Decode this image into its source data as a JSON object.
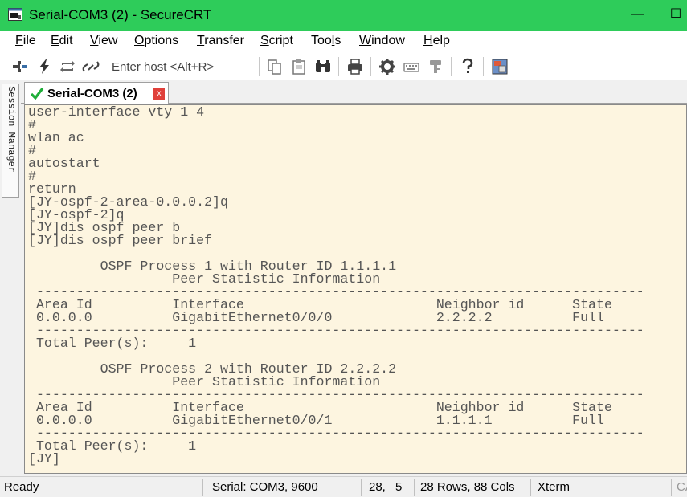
{
  "window": {
    "title": "Serial-COM3 (2) - SecureCRT",
    "minimize_glyph": "—",
    "maximize_glyph": "☐"
  },
  "menu": [
    {
      "label": "File",
      "accel": "F",
      "rest": "ile"
    },
    {
      "label": "Edit",
      "accel": "E",
      "rest": "dit"
    },
    {
      "label": "View",
      "accel": "V",
      "rest": "iew"
    },
    {
      "label": "Options",
      "accel": "O",
      "rest": "ptions"
    },
    {
      "label": "Transfer",
      "accel": "T",
      "rest": "ransfer"
    },
    {
      "label": "Script",
      "accel": "S",
      "rest": "cript"
    },
    {
      "label": "Tools",
      "pre": "Too",
      "accel": "l",
      "rest": "s"
    },
    {
      "label": "Window",
      "accel": "W",
      "rest": "indow"
    },
    {
      "label": "Help",
      "accel": "H",
      "rest": "elp"
    }
  ],
  "toolbar": {
    "host_placeholder": "Enter host <Alt+R>",
    "icons": [
      "connect-bar-icon",
      "quick-connect-icon",
      "reconnect-icon",
      "disconnect-icon",
      "copy-icon",
      "paste-icon",
      "find-icon",
      "print-icon",
      "settings-icon",
      "keymap-icon",
      "key-agent-icon",
      "help-icon",
      "sftp-icon"
    ]
  },
  "side_panel": {
    "label": "Session Manager"
  },
  "session_tab": {
    "label": "Serial-COM3 (2)",
    "close": "x"
  },
  "terminal": {
    "lines": [
      "user-interface vty 1 4",
      "#",
      "wlan ac",
      "#",
      "autostart",
      "#",
      "return",
      "[JY-ospf-2-area-0.0.0.2]q",
      "[JY-ospf-2]q",
      "[JY]dis ospf peer b",
      "[JY]dis ospf peer brief",
      "",
      "         OSPF Process 1 with Router ID 1.1.1.1",
      "                  Peer Statistic Information",
      " ----------------------------------------------------------------------------",
      " Area Id          Interface                        Neighbor id      State",
      " 0.0.0.0          GigabitEthernet0/0/0             2.2.2.2          Full",
      " ----------------------------------------------------------------------------",
      " Total Peer(s):     1",
      "",
      "         OSPF Process 2 with Router ID 2.2.2.2",
      "                  Peer Statistic Information",
      " ----------------------------------------------------------------------------",
      " Area Id          Interface                        Neighbor id      State",
      " 0.0.0.0          GigabitEthernet0/0/1             1.1.1.1          Full",
      " ----------------------------------------------------------------------------",
      " Total Peer(s):     1",
      "[JY]"
    ]
  },
  "status": {
    "state": "Ready",
    "connection": "Serial: COM3, 9600",
    "cursor_row": "28,",
    "cursor_col": "5",
    "size": "28 Rows, 88 Cols",
    "emulation": "Xterm",
    "caps": "CA"
  },
  "colors": {
    "titlebar": "#2ecc5a",
    "terminal_bg": "#fdf5e0",
    "terminal_fg": "#555555"
  }
}
